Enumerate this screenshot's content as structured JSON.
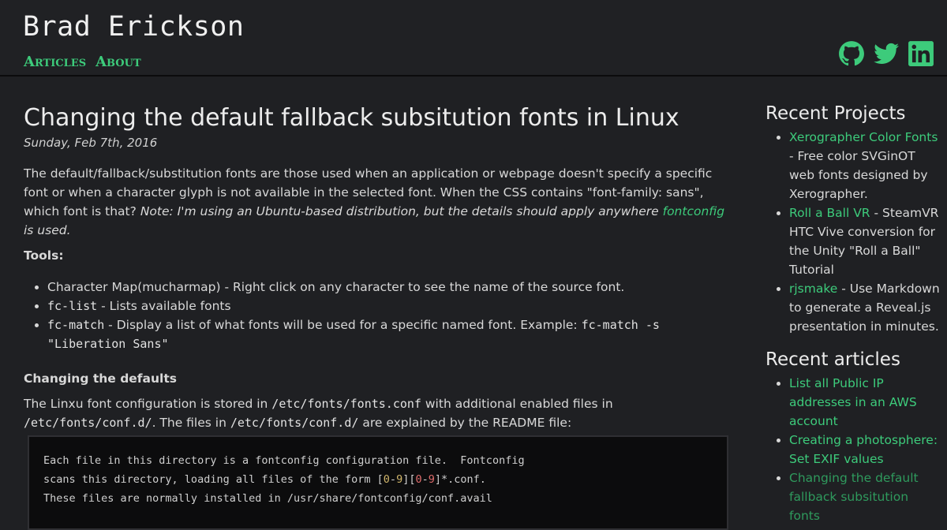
{
  "header": {
    "site_title": "Brad Erickson",
    "nav": [
      {
        "label": "Articles"
      },
      {
        "label": "About"
      }
    ],
    "social": [
      "github-icon",
      "twitter-icon",
      "linkedin-icon"
    ]
  },
  "post": {
    "title": "Changing the default fallback subsitution fonts in Linux",
    "date": "Sunday, Feb 7th, 2016",
    "intro": "The default/fallback/substitution fonts are those used when an application or webpage doesn't specify a specific font or when a character glyph is not available in the selected font. When the CSS contains \"font-family: sans\", which font is that?",
    "note_prefix": "Note: I'm using an Ubuntu-based distribution, but the details should apply anywhere ",
    "note_link": "fontconfig",
    "note_suffix": " is used.",
    "tools_heading": "Tools:",
    "tools": [
      {
        "code": "",
        "text": "Character Map(mucharmap) - Right click on any character to see the name of the source font."
      },
      {
        "code": "fc-list",
        "text": " - Lists available fonts"
      },
      {
        "code": "fc-match",
        "text": " - Display a list of what fonts will be used for a specific named font. Example: ",
        "example": "fc-match -s \"Liberation Sans\""
      }
    ],
    "section_heading": "Changing the defaults",
    "config_p": {
      "t1": "The Linxu font configuration is stored in ",
      "c1": "/etc/fonts/fonts.conf",
      "t2": " with additional enabled files in ",
      "c2": "/etc/fonts/conf.d/",
      "t3": ". The files in ",
      "c3": "/etc/fonts/conf.d/",
      "t4": " are explained by the README file:"
    },
    "code_lines": {
      "l1": "Each file in this directory is a fontconfig configuration file.  Fontconfig",
      "l2a": "scans this directory, loading all files of the form [",
      "l2b": "0",
      "l2c": "-",
      "l2d": "9",
      "l2e": "][",
      "l2f": "0",
      "l2g": "-",
      "l2h": "9",
      "l2i": "]*.conf.",
      "l3": "These files are normally installed in /usr/share/fontconfig/conf.avail"
    }
  },
  "sidebar": {
    "projects_heading": "Recent Projects",
    "projects": [
      {
        "link": "Xerographer Color Fonts",
        "desc": " - Free color SVGinOT web fonts designed by Xerographer."
      },
      {
        "link": "Roll a Ball VR",
        "desc": " - SteamVR HTC Vive conversion for the Unity \"Roll a Ball\" Tutorial"
      },
      {
        "link": "rjsmake",
        "desc": " - Use Markdown to generate a Reveal.js presentation in minutes."
      }
    ],
    "articles_heading": "Recent articles",
    "articles": [
      {
        "link": "List all Public IP addresses in an AWS account"
      },
      {
        "link": "Creating a photosphere: Set EXIF values"
      },
      {
        "link": "Changing the default fallback subsitution fonts"
      }
    ]
  },
  "colors": {
    "background": "#1f2023",
    "accent": "#3dcb7b",
    "text": "#d8d8d8"
  }
}
